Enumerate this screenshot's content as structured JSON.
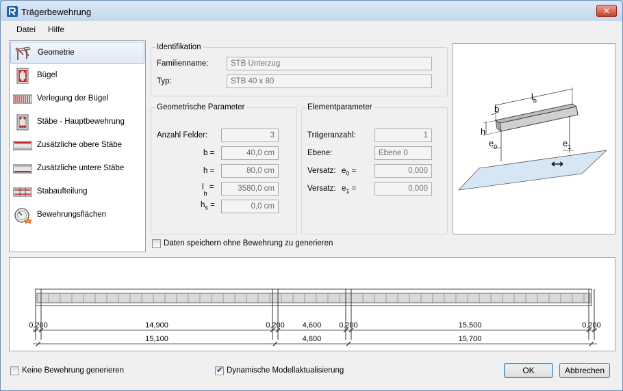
{
  "window": {
    "title": "Trägerbewehrung",
    "close_label": "✕"
  },
  "menu": {
    "items": [
      "Datei",
      "Hilfe"
    ]
  },
  "nav": {
    "items": [
      {
        "label": "Geometrie",
        "icon": "geometry-icon",
        "selected": true
      },
      {
        "label": "Bügel",
        "icon": "stirrup-icon"
      },
      {
        "label": "Verlegung der Bügel",
        "icon": "stirrup-layout-icon"
      },
      {
        "label": "Stäbe - Hauptbewehrung",
        "icon": "main-bars-icon"
      },
      {
        "label": "Zusätzliche obere Stäbe",
        "icon": "top-bars-icon"
      },
      {
        "label": "Zusätzliche untere Stäbe",
        "icon": "bottom-bars-icon"
      },
      {
        "label": "Stabaufteilung",
        "icon": "bar-distribution-icon"
      },
      {
        "label": "Bewehrungsflächen",
        "icon": "reinforcement-areas-icon"
      }
    ]
  },
  "identification": {
    "title": "Identifikation",
    "family_label": "Familienname:",
    "family_value": "STB Unterzug",
    "type_label": "Typ:",
    "type_value": "STB 40 x 80"
  },
  "geometry": {
    "title": "Geometrische Parameter",
    "spans_label": "Anzahl Felder:",
    "spans_value": "3",
    "b_label": "b =",
    "b_value": "40,0 cm",
    "h_label": "h =",
    "h_value": "80,0 cm",
    "lb_label": "l",
    "lb_sub": "b",
    "lb_eq": "=",
    "lb_value": "3580,0 cm",
    "hs_label": "h",
    "hs_sub": "s",
    "hs_eq": "=",
    "hs_value": "0,0 cm"
  },
  "element": {
    "title": "Elementparameter",
    "count_label": "Trägeranzahl:",
    "count_value": "1",
    "level_label": "Ebene:",
    "level_value": "Ebene 0",
    "offset0_label": "Versatz:",
    "offset0_sym": "e",
    "offset0_sub": "0",
    "offset0_eq": "=",
    "offset0_value": "0,000",
    "offset1_label": "Versatz:",
    "offset1_sym": "e",
    "offset1_sub": "1",
    "offset1_eq": "=",
    "offset1_value": "0,000"
  },
  "preview": {
    "lb": "l",
    "lb_sub": "b",
    "b": "b",
    "h": "h",
    "e0": "e",
    "e0_sub": "0",
    "e1": "e",
    "e1_sub": "1"
  },
  "save_without_reinforcement": {
    "label": "Daten speichern ohne Bewehrung zu generieren",
    "checked": false
  },
  "beam_dims": {
    "supports": [
      "0,200",
      "0,200",
      "0,200",
      "0,200"
    ],
    "clear_spans": [
      "14,900",
      "4,600",
      "15,500"
    ],
    "spans": [
      "15,100",
      "4,800",
      "15,700"
    ]
  },
  "footer": {
    "no_reinforcement": {
      "label": "Keine Bewehrung generieren",
      "checked": false
    },
    "dynamic_update": {
      "label": "Dynamische Modellaktualisierung",
      "checked": true
    },
    "ok_label": "OK",
    "cancel_label": "Abbrechen"
  },
  "colors": {
    "accent": "#3c7fb1",
    "rebar_red": "#c0262d",
    "beam_gray": "#d9d9d9"
  }
}
